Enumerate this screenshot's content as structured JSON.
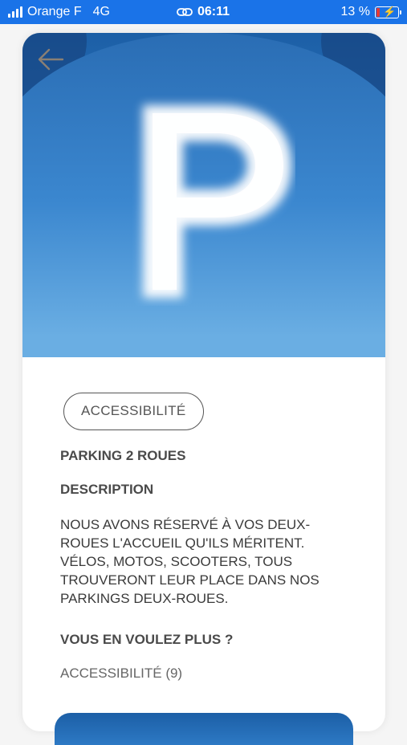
{
  "status_bar": {
    "carrier": "Orange F",
    "network": "4G",
    "time": "06:11",
    "battery": "13 %",
    "battery_level": 0.13,
    "battery_color": "#e53935",
    "bar_color": "#1a73e8"
  },
  "hero": {
    "image_icon": "cloud-letter-p-icon",
    "back_icon": "arrow-left-icon"
  },
  "detail": {
    "tag": "ACCESSIBILITÉ",
    "title": "PARKING 2 ROUES",
    "description_heading": "DESCRIPTION",
    "description": "NOUS AVONS RÉSERVÉ À VOS DEUX-ROUES L'ACCUEIL QU'ILS MÉRITENT. VÉLOS, MOTOS, SCOOTERS, TOUS TROUVERONT LEUR PLACE DANS NOS PARKINGS DEUX-ROUES.",
    "more_heading": "VOUS EN VOULEZ PLUS ?",
    "more_link": "ACCESSIBILITÉ (9)"
  }
}
